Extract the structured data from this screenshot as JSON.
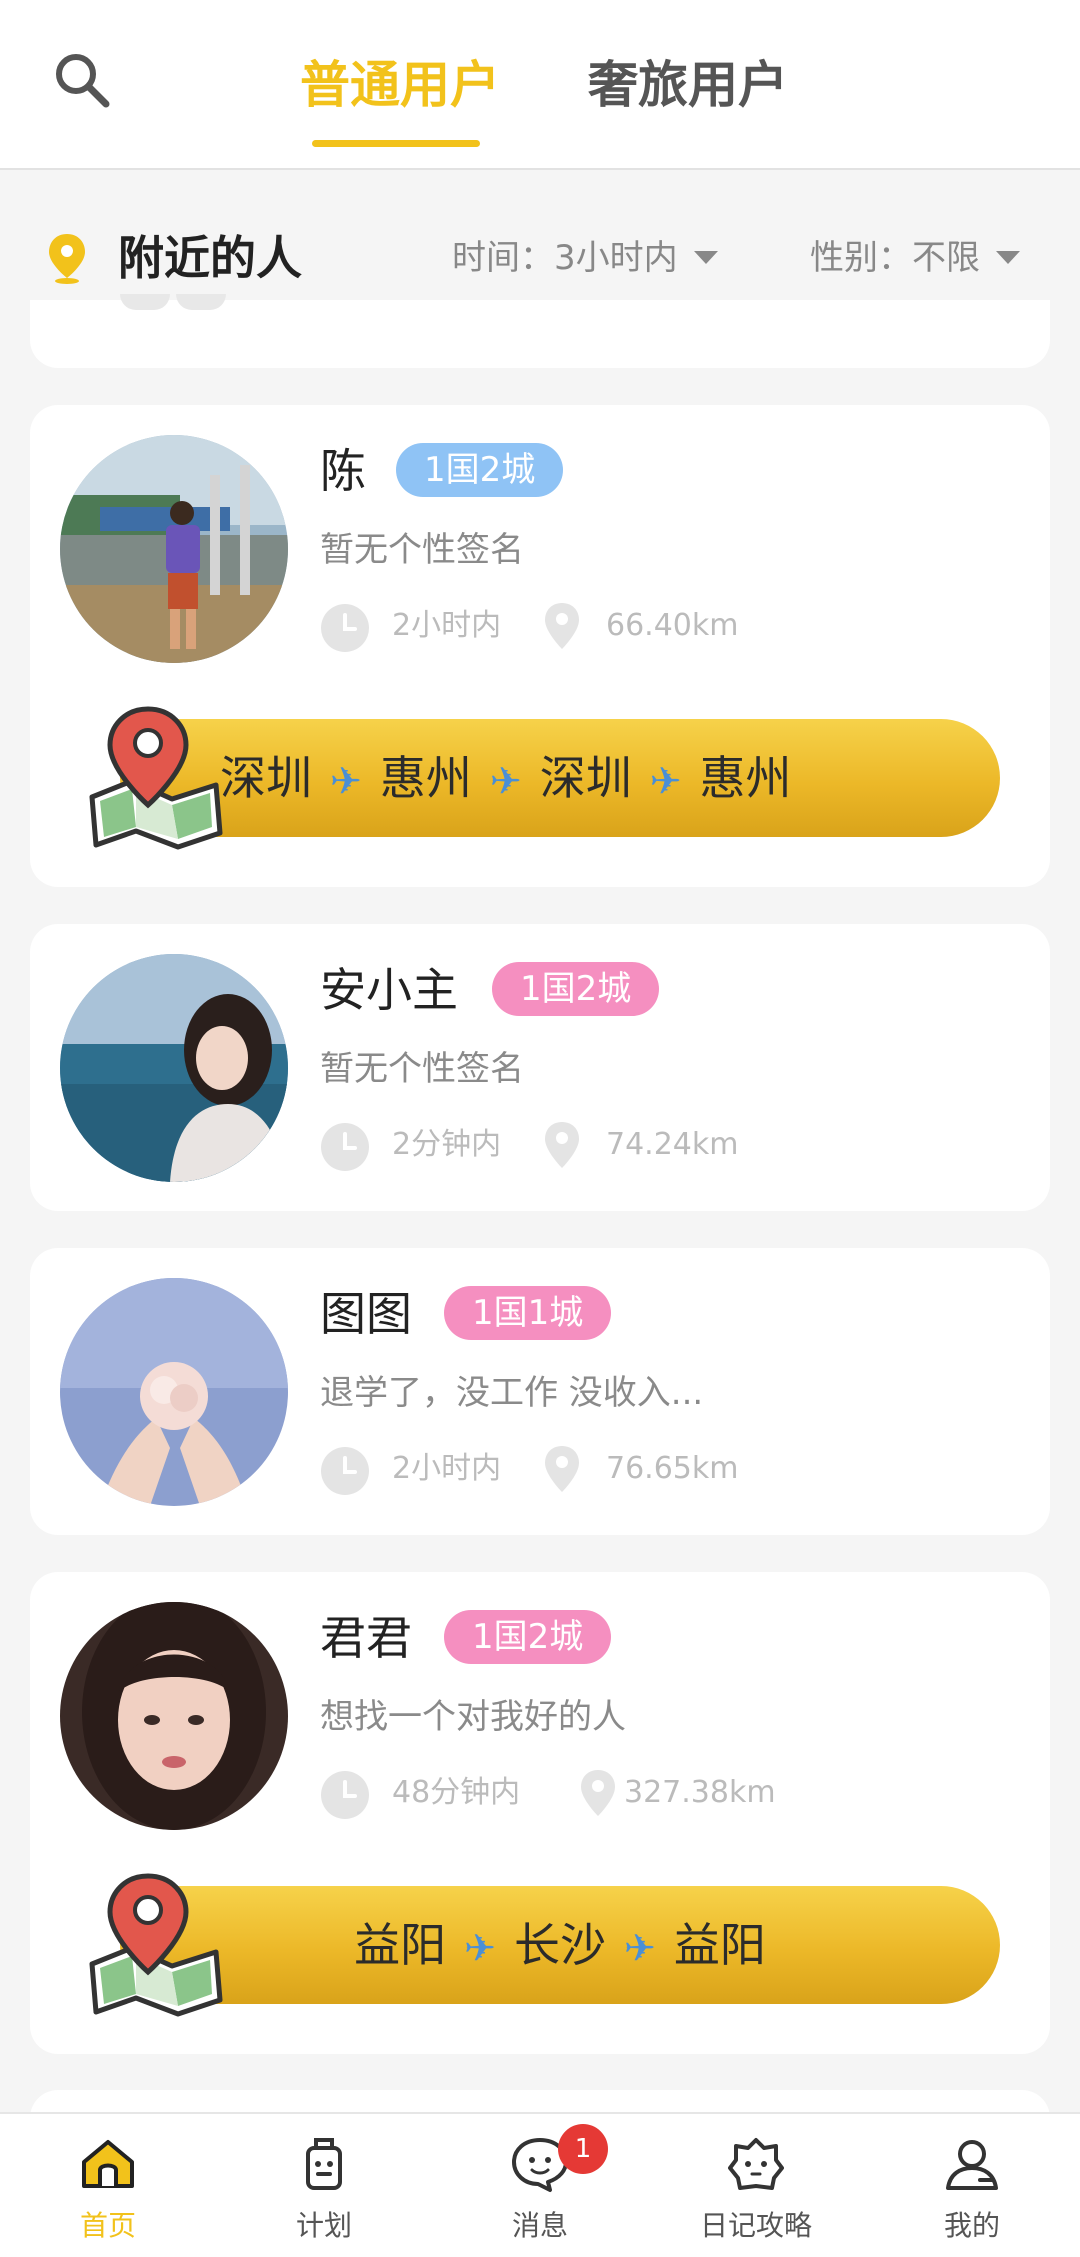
{
  "tabs": {
    "normal": "普通用户",
    "luxury": "奢旅用户"
  },
  "filter": {
    "title": "附近的人",
    "time_label": "时间：3小时内",
    "gender_label": "性别：不限"
  },
  "users": [
    {
      "name": "陈",
      "badge": "1国2城",
      "signature": "暂无个性签名",
      "time": "2小时内",
      "distance": "66.40km",
      "route": [
        "深圳",
        "惠州",
        "深圳",
        "惠州"
      ]
    },
    {
      "name": "安小主",
      "badge": "1国2城",
      "signature": "暂无个性签名",
      "time": "2分钟内",
      "distance": "74.24km"
    },
    {
      "name": "图图",
      "badge": "1国1城",
      "signature": "退学了，没工作 没收入...",
      "time": "2小时内",
      "distance": "76.65km"
    },
    {
      "name": "君君",
      "badge": "1国2城",
      "signature": "想找一个对我好的人",
      "time": "48分钟内",
      "distance": "327.38km",
      "route": [
        "益阳",
        "长沙",
        "益阳"
      ]
    }
  ],
  "nav": {
    "home": "首页",
    "plan": "计划",
    "messages": "消息",
    "messages_badge": "1",
    "diary": "日记攻略",
    "mine": "我的"
  },
  "colors": {
    "accent": "#f2c21b",
    "badge_blue": "#8fc3f5",
    "badge_pink": "#f58fc0",
    "notif": "#e53935"
  }
}
